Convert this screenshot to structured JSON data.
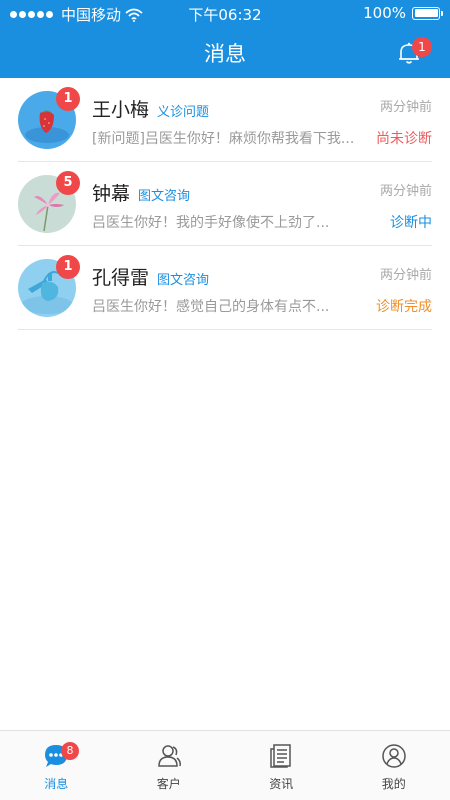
{
  "statusbar": {
    "carrier": "中国移动",
    "time": "下午06:32",
    "battery": "100%"
  },
  "navbar": {
    "title": "消息",
    "notification_count": "1"
  },
  "messages": [
    {
      "name": "王小梅",
      "tag": "义诊问题",
      "time": "两分钟前",
      "preview": "[新问题]吕医生你好！麻烦你帮我看下我...",
      "status": "尚未诊断",
      "status_color": "#f05a5a",
      "unread": "1"
    },
    {
      "name": "钟幕",
      "tag": "图文咨询",
      "time": "两分钟前",
      "preview": "吕医生你好！我的手好像使不上劲了...",
      "status": "诊断中",
      "status_color": "#1a8fe0",
      "unread": "5"
    },
    {
      "name": "孔得雷",
      "tag": "图文咨询",
      "time": "两分钟前",
      "preview": "吕医生你好！感觉自己的身体有点不...",
      "status": "诊断完成",
      "status_color": "#f0902a",
      "unread": "1"
    }
  ],
  "tabbar": {
    "tabs": [
      {
        "label": "消息",
        "icon": "chat-bubble-icon",
        "active": true,
        "badge": "8"
      },
      {
        "label": "客户",
        "icon": "users-icon",
        "active": false
      },
      {
        "label": "资讯",
        "icon": "newspaper-icon",
        "active": false
      },
      {
        "label": "我的",
        "icon": "profile-icon",
        "active": false
      }
    ]
  },
  "colors": {
    "primary": "#1a8fe0",
    "badge": "#f04848"
  }
}
